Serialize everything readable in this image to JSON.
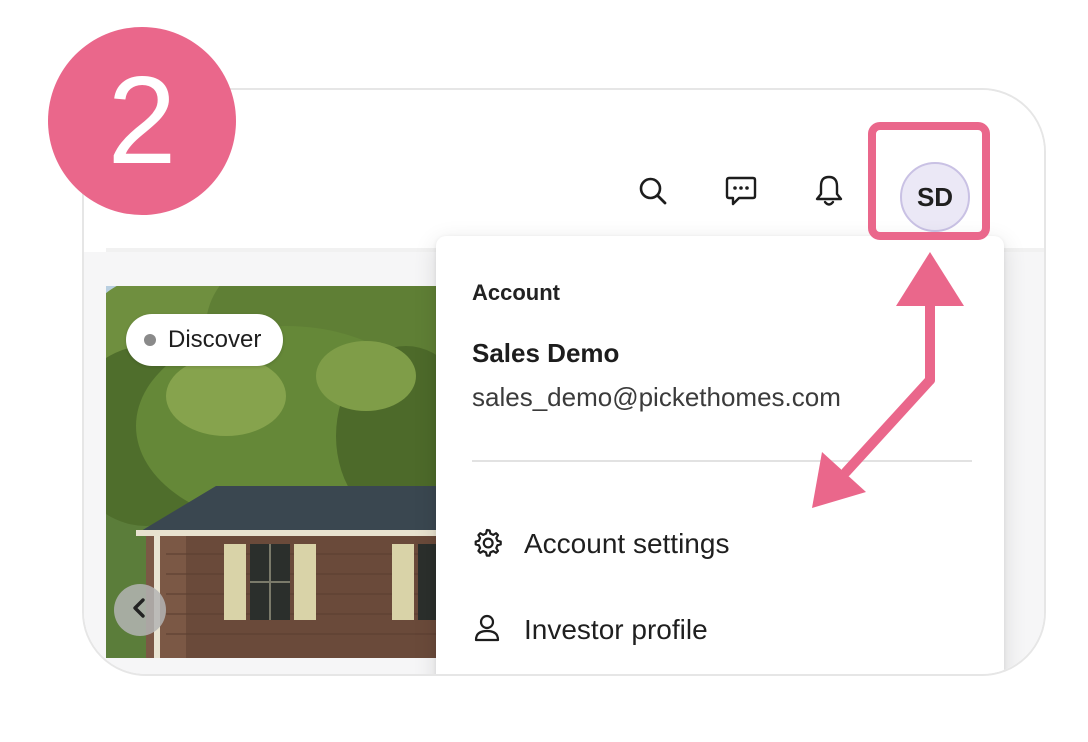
{
  "step": {
    "number": "2"
  },
  "header": {
    "search_icon": "search-icon",
    "messages_icon": "chat-bubble-icon",
    "notifications_icon": "bell-icon",
    "avatar_initials": "SD"
  },
  "listing": {
    "badge_label": "Discover",
    "prev_icon": "chevron-left-icon"
  },
  "account_menu": {
    "section_title": "Account",
    "user_name": "Sales Demo",
    "user_email": "sales_demo@pickethomes.com",
    "items": [
      {
        "label": "Account settings",
        "icon": "gear-icon"
      },
      {
        "label": "Investor profile",
        "icon": "person-icon"
      }
    ]
  },
  "colors": {
    "accent": "#ea678b",
    "avatar_bg": "#ebe8f6",
    "text": "#1f1f1f"
  }
}
